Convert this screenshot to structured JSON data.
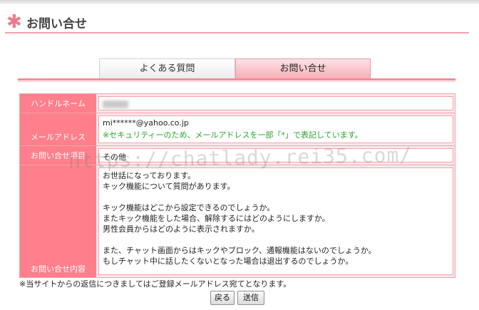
{
  "header": {
    "icon": "asterisk-flower-icon",
    "title": "お問い合せ"
  },
  "tabs": [
    {
      "label": "よくある質問",
      "active": false
    },
    {
      "label": "お問い合せ",
      "active": true
    }
  ],
  "form": {
    "handle": {
      "label": "ハンドルネーム",
      "value_blurred": true
    },
    "email": {
      "label": "メールアドレス",
      "value": "mi******@yahoo.co.jp",
      "note": "※セキュリティーのため、メールアドレスを一部「*」で表記しています。"
    },
    "category": {
      "label": "お問い合せ項目",
      "value": "その他"
    },
    "message": {
      "label": "お問い合せ内容",
      "lines": [
        "お世話になっております。",
        "キック機能について質問があります。",
        "",
        "キック機能はどこから設定できるのでしょうか。",
        "またキック機能をした場合、解除するにはどのようにしますか。",
        "男性会員からはどのように表示されますか。",
        "",
        "また、チャット画面からはキックやブロック、通報機能はないのでしょうか。",
        "もしチャット中に話したくないとなった場合は退出するのでしょうか。"
      ]
    }
  },
  "watermark": "https://chatlady.rei35.com/",
  "footer_note": "※当サイトからの返信につきましてはご登録メールアドレス宛てとなります。",
  "buttons": {
    "back": "戻る",
    "send": "送信"
  },
  "colors": {
    "accent": "#ff7f8c",
    "tab_active": "#f7aeb8",
    "green_note": "#2aa52a"
  }
}
